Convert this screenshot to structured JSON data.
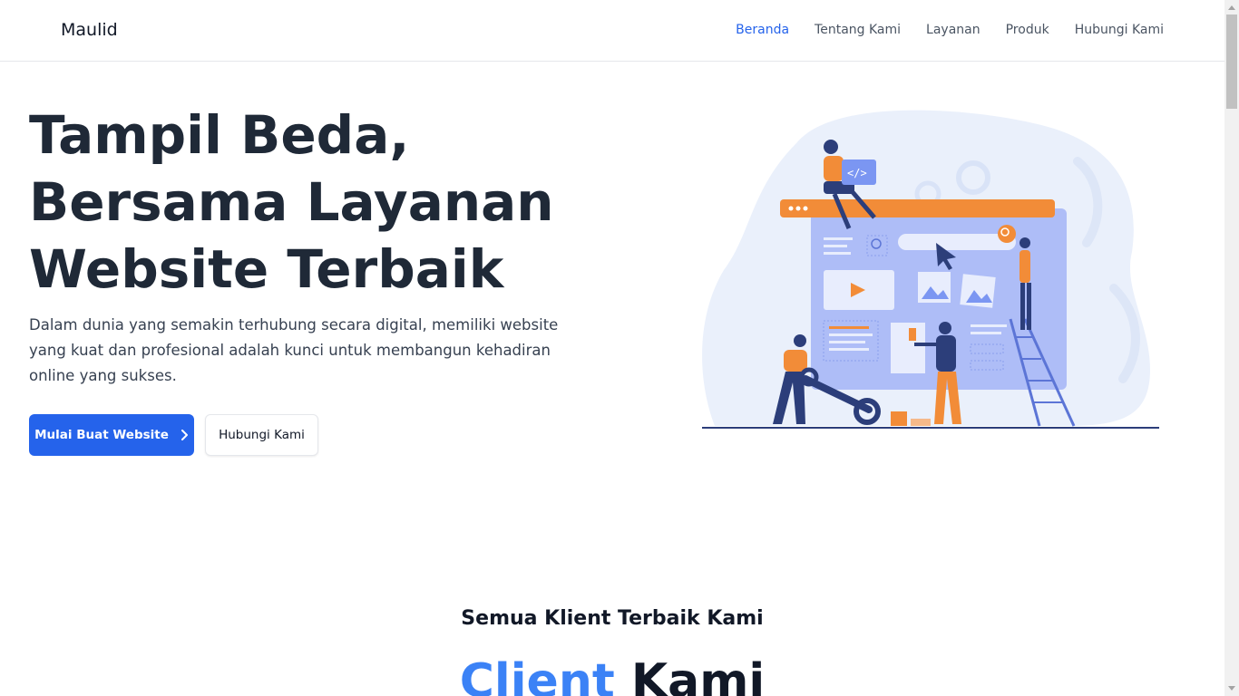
{
  "brand": "Maulid",
  "nav": {
    "items": [
      {
        "label": "Beranda",
        "active": true
      },
      {
        "label": "Tentang Kami",
        "active": false
      },
      {
        "label": "Layanan",
        "active": false
      },
      {
        "label": "Produk",
        "active": false
      },
      {
        "label": "Hubungi Kami",
        "active": false
      }
    ]
  },
  "hero": {
    "title_lines": [
      "Tampil Beda,",
      "Bersama Layanan",
      "Website Terbaik"
    ],
    "description": "Dalam dunia yang semakin terhubung secara digital, memiliki website yang kuat dan profesional adalah kunci untuk membangun kehadiran online yang sukses.",
    "primary_button": "Mulai Buat Website",
    "secondary_button": "Hubungi Kami",
    "illustration_icon": "web-development-team-illustration"
  },
  "clients": {
    "subtitle": "Semua Klient Terbaik Kami",
    "title_accent": "Client",
    "title_rest": "Kami"
  },
  "colors": {
    "primary": "#2563eb",
    "accent_blue": "#3b82f6",
    "heading": "#1f2937",
    "illustration_orange": "#f28c38",
    "illustration_blue": "#7b96f2"
  }
}
